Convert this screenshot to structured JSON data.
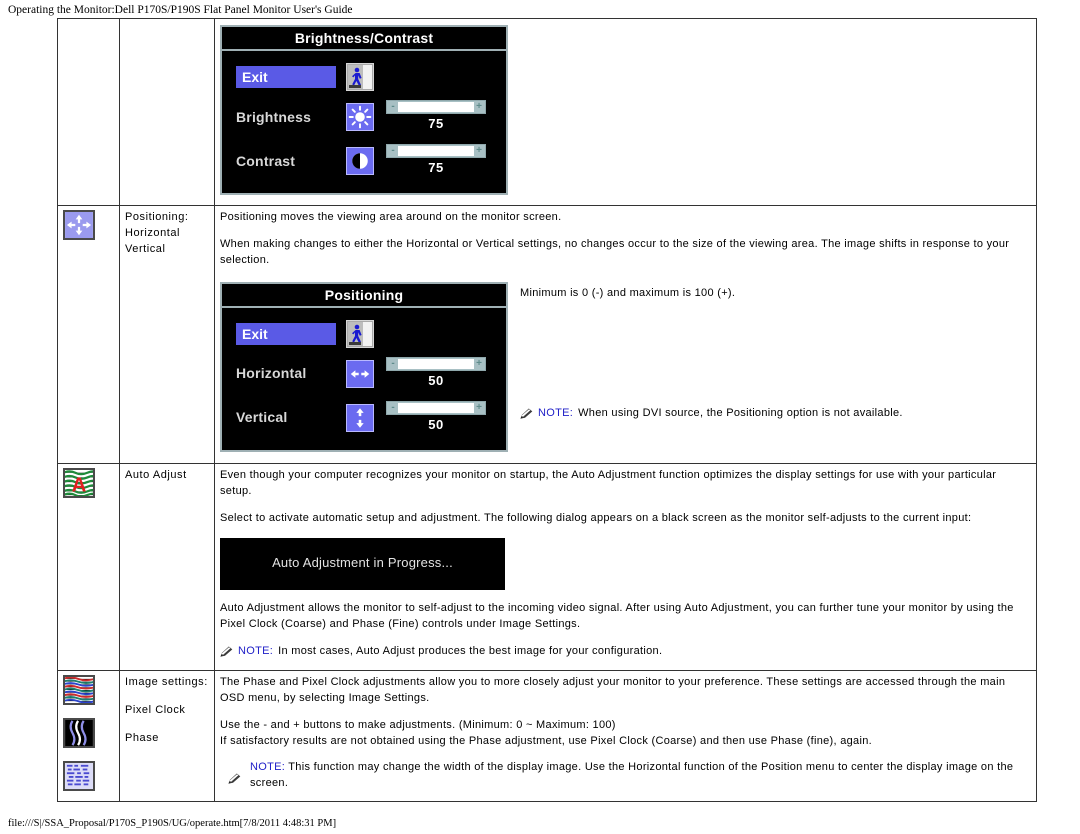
{
  "page": {
    "header": "Operating the Monitor:Dell P170S/P190S Flat Panel Monitor User's Guide",
    "footer": "file:///S|/SSA_Proposal/P170S_P190S/UG/operate.htm[7/8/2011 4:48:31 PM]"
  },
  "colors": {
    "osd_highlight": "#5a5ae6",
    "osd_icon_bg": "#6b6bf0",
    "osd_border": "#9fb0b4",
    "osd_bg": "#000000",
    "slider_track_fill": "#8a8a8a",
    "slider_rail": "#a8c0c4",
    "note_blue": "#2121c8"
  },
  "rows": [
    {
      "id": "brightness-contrast",
      "icon": "brightness-contrast-thumb-icon",
      "name_lines": [],
      "osd": {
        "title": "Brightness/Contrast",
        "exit_label": "Exit",
        "exit_icon": "exit-door-running-man-icon",
        "items": [
          {
            "label": "Brightness",
            "icon": "sun-brightness-icon",
            "value": "75",
            "fill_percent": 75,
            "minus": "-",
            "plus": "+"
          },
          {
            "label": "Contrast",
            "icon": "half-circle-contrast-icon",
            "value": "75",
            "fill_percent": 75,
            "minus": "-",
            "plus": "+"
          }
        ]
      }
    },
    {
      "id": "positioning",
      "icon": "four-arrows-positioning-thumb-icon",
      "name_lines": [
        "Positioning:",
        "Horizontal",
        "Vertical"
      ],
      "paragraphs": [
        "Positioning moves the viewing area around on the monitor screen.",
        "When making changes to either the Horizontal or Vertical settings, no changes occur to the size of the viewing area. The image shifts in response to your selection."
      ],
      "side_text": "Minimum is 0 (-) and maximum is 100 (+).",
      "note": {
        "label": "NOTE:",
        "text": "When using  DVI source, the Positioning option is not available."
      },
      "osd": {
        "title": "Positioning",
        "exit_label": "Exit",
        "exit_icon": "exit-door-running-man-icon",
        "items": [
          {
            "label": "Horizontal",
            "icon": "left-right-arrows-icon",
            "value": "50",
            "fill_percent": 50,
            "minus": "-",
            "plus": "+"
          },
          {
            "label": "Vertical",
            "icon": "up-down-arrows-icon",
            "value": "50",
            "fill_percent": 50,
            "minus": "-",
            "plus": "+"
          }
        ]
      }
    },
    {
      "id": "auto-adjust",
      "icon": "auto-adjust-letter-a-thumb-icon",
      "name_lines": [
        "Auto Adjust"
      ],
      "paragraphs": [
        "Even though your computer recognizes your monitor on startup, the Auto Adjustment function optimizes the display settings for use with your particular setup.",
        "Select to activate automatic setup and adjustment. The following dialog appears on a black screen as the monitor self-adjusts to the current input:"
      ],
      "dialog_text": "Auto Adjustment in Progress...",
      "paragraph_after": "Auto Adjustment allows the monitor to self-adjust to the incoming video signal. After using Auto Adjustment, you can further tune your monitor by using the Pixel Clock (Coarse) and Phase (Fine) controls under Image Settings.",
      "note": {
        "label": "NOTE:",
        "text": "In most cases, Auto Adjust produces the best image for your configuration."
      }
    },
    {
      "id": "image-settings",
      "icons": [
        "image-settings-stripes-thumb-icon",
        "pixel-clock-waves-thumb-icon",
        "phase-dashes-thumb-icon"
      ],
      "name_lines": [
        "Image settings:",
        "Pixel Clock",
        "Phase"
      ],
      "paragraphs": [
        "The Phase and Pixel Clock adjustments allow you to more closely adjust your monitor to your preference. These settings are accessed through the main OSD menu, by selecting Image Settings."
      ],
      "lines": [
        "Use the - and + buttons to make adjustments. (Minimum: 0 ~ Maximum: 100)",
        "If satisfactory results are not obtained using the Phase adjustment, use Pixel Clock (Coarse) and then use Phase (fine), again."
      ],
      "note": {
        "label": "NOTE:",
        "text": " This function may change the width of the display image.  Use the Horizontal function of the Position menu to center the display image on the screen."
      }
    }
  ]
}
